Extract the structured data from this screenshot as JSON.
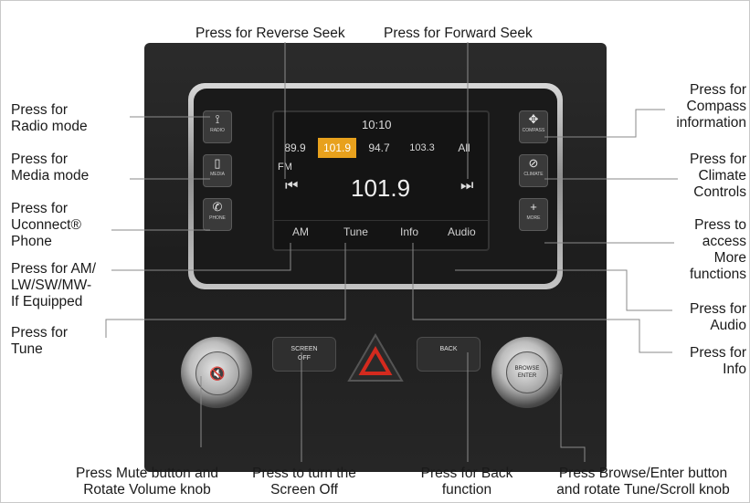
{
  "annotations": {
    "reverse_seek": "Press for Reverse Seek",
    "forward_seek": "Press for Forward Seek",
    "radio_mode": "Press for\nRadio mode",
    "media_mode": "Press for\nMedia mode",
    "uconnect_phone": "Press for\nUconnect®\nPhone",
    "am_lw": "Press for AM/\nLW/SW/MW-\nIf Equipped",
    "tune": "Press for\nTune",
    "compass": "Press for\nCompass\ninformation",
    "climate": "Press for\nClimate\nControls",
    "more": "Press to\naccess\nMore\nfunctions",
    "audio": "Press for\nAudio",
    "info": "Press for\nInfo",
    "mute_volume": "Press Mute button and\nRotate Volume knob",
    "screen_off": "Press to turn the\nScreen Off",
    "back": "Press for Back\nfunction",
    "browse_enter": "Press Browse/Enter button\nand rotate Tune/Scroll knob"
  },
  "screen": {
    "time": "10:10",
    "presets": [
      "89.9",
      "101.9",
      "94.7",
      "103.3",
      "All"
    ],
    "selected_preset": "101.9",
    "band": "FM",
    "frequency": "101.9",
    "prev_glyph": "⏮",
    "next_glyph": "⏭",
    "softkeys": [
      "AM",
      "Tune",
      "Info",
      "Audio"
    ]
  },
  "buttons": {
    "radio_label": "RADIO",
    "media_label": "MEDIA",
    "phone_label": "PHONE",
    "compass_label": "COMPASS",
    "climate_label": "CLIMATE",
    "more_label": "MORE",
    "screen_off_label": "SCREEN\nOFF",
    "back_label": "BACK",
    "volume_label": "VOLUME",
    "browse_label": "BROWSE\nENTER"
  },
  "colors": {
    "accent": "#e8a11d",
    "hazard": "#d42a1e",
    "leader": "#8a8a8a"
  }
}
